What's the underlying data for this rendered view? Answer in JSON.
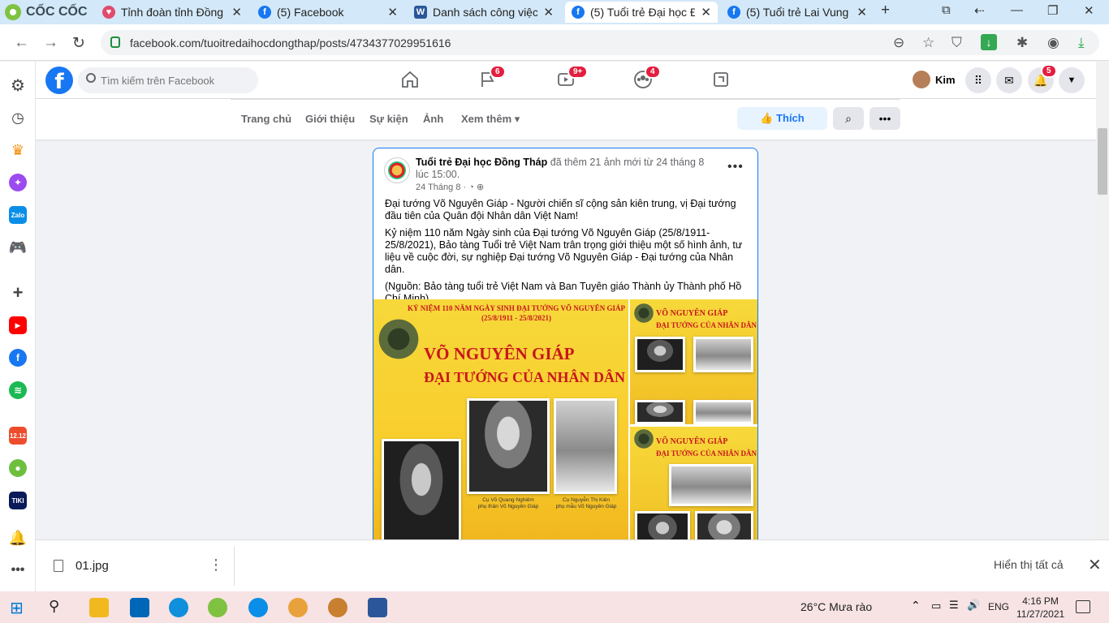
{
  "browser": {
    "name": "CỐC CỐC",
    "tabs": [
      {
        "title": "Tỉnh đoàn tỉnh Đồng",
        "icon": "heart-favicon-icon",
        "color": "#e14b6c"
      },
      {
        "title": "(5) Facebook",
        "icon": "facebook-favicon-icon",
        "color": "#1877f2"
      },
      {
        "title": "Danh sách công việc",
        "icon": "word-favicon-icon",
        "color": "#2b579a"
      },
      {
        "title": "(5) Tuổi trẻ Đại học Đ",
        "icon": "facebook-favicon-icon",
        "color": "#1877f2"
      },
      {
        "title": "(5) Tuổi trẻ Lai Vung",
        "icon": "facebook-favicon-icon",
        "color": "#1877f2"
      }
    ],
    "url": "facebook.com/tuoitredaihocdongthap/posts/4734377029951616"
  },
  "facebook": {
    "search_placeholder": "Tìm kiếm trên Facebook",
    "badges": {
      "pages": "6",
      "watch": "9+",
      "groups": "4",
      "notifications": "5"
    },
    "profile_name": "Kim",
    "page_tabs": [
      "Trang chủ",
      "Giới thiệu",
      "Sự kiện",
      "Ảnh",
      "Xem thêm ▾"
    ],
    "like_label": "Thích",
    "accent": "#1877f2"
  },
  "post": {
    "page_name": "Tuổi trẻ Đại học Đồng Tháp",
    "action": " đã thêm 21 ảnh mới từ 24 tháng 8 lúc 15:00.",
    "date": "24 Tháng 8 ·",
    "paragraphs": [
      "Đại tướng Võ Nguyên Giáp - Người chiến sĩ cộng sản kiên trung, vị Đại tướng đầu tiên của Quân đội Nhân dân Việt Nam!",
      "Kỷ niệm 110 năm Ngày sinh của Đại tướng Võ Nguyên Giáp (25/8/1911-25/8/2021), Bảo tàng Tuổi trẻ Việt Nam trân trọng giới thiệu một số hình ảnh, tư liệu về cuộc đời, sự nghiệp Đại tướng Võ Nguyên Giáp - Đại tướng của Nhân dân.",
      "(Nguồn: Bảo tàng tuổi trẻ Việt Nam và Ban Tuyên giáo Thành ủy Thành phố Hồ Chí Minh)"
    ],
    "poster": {
      "banner": "KỶ NIỆM 110 NĂM NGÀY SINH ĐẠI TƯỚNG VÕ NGUYÊN GIÁP",
      "banner_dates": "(25/8/1911 - 25/8/2021)",
      "title_line1": "VÕ NGUYÊN GIÁP",
      "title_line2": "ĐẠI TƯỚNG CỦA NHÂN DÂN",
      "caption_father": "Cụ Võ Quang Nghiêm\nphụ thân Võ Nguyên Giáp",
      "caption_mother": "Cụ Nguyễn Thị Kiên\nphụ mẫu Võ Nguyên Giáp"
    }
  },
  "downloads": {
    "file_name": "01.jpg",
    "show_all": "Hiển thị tất cả"
  },
  "taskbar": {
    "weather": "26°C  Mưa rào",
    "language": "ENG",
    "time": "4:16 PM",
    "date": "11/27/2021"
  }
}
